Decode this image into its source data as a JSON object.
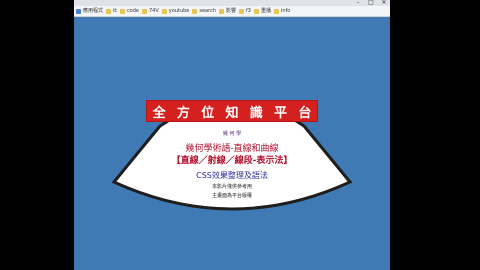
{
  "browser": {
    "bookmarks": [
      {
        "label": "應用程式",
        "icon": "apps-icon"
      },
      {
        "label": "tt",
        "icon": "folder-icon"
      },
      {
        "label": "code",
        "icon": "folder-icon"
      },
      {
        "label": "74V",
        "icon": "folder-icon"
      },
      {
        "label": "youtube",
        "icon": "folder-icon"
      },
      {
        "label": "search",
        "icon": "folder-icon"
      },
      {
        "label": "影響",
        "icon": "folder-icon"
      },
      {
        "label": "f3",
        "icon": "folder-icon"
      },
      {
        "label": "重播",
        "icon": "folder-icon"
      },
      {
        "label": "info",
        "icon": "folder-icon"
      }
    ],
    "window_controls": [
      "–",
      "□",
      "✕"
    ]
  },
  "slide": {
    "banner_chars": [
      "全",
      "方",
      "位",
      "知",
      "識",
      "平",
      "台"
    ],
    "subject": "幾 何 學",
    "line1": "幾何學術語-直線和曲線",
    "line2": "【直線／射線／線段-表示法】",
    "css_line": "CSS效果整理及語法",
    "note1": "本影片僅供參考用",
    "note2": "主畫面為平台版權"
  },
  "colors": {
    "page_bg": "#3f7ab4",
    "sign_fill": "#ffffff",
    "sign_border": "#1e1e1e",
    "banner_red": "#d52020"
  }
}
